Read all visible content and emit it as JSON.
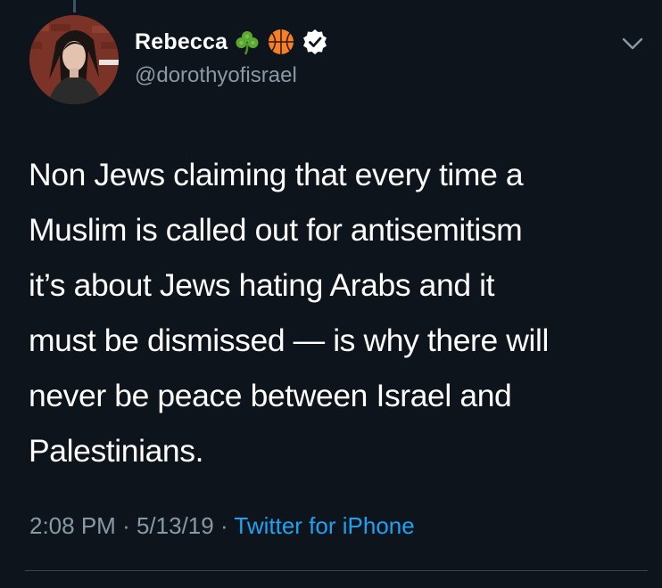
{
  "tweet": {
    "author": {
      "display_name": "Rebecca",
      "handle": "@dorothyofisrael",
      "badges": [
        "shamrock-icon",
        "basketball-icon",
        "verified-badge-icon"
      ]
    },
    "text": "Non Jews claiming that every time a\nMuslim is called out for antisemitism\nit’s about Jews hating Arabs and it\nmust be dismissed — is why there will\nnever be peace between Israel and\nPalestinians.",
    "time": "2:08 PM",
    "separator": "·",
    "date": "5/13/19",
    "source": "Twitter for iPhone"
  },
  "colors": {
    "background": "#0e141c",
    "text_primary": "#ffffff",
    "text_secondary": "#8899a6",
    "link": "#1da1f2",
    "divider": "#38444d"
  }
}
